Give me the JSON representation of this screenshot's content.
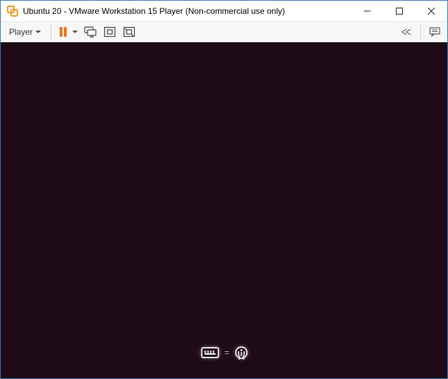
{
  "window": {
    "title": "Ubuntu 20 - VMware Workstation 15 Player (Non-commercial use only)"
  },
  "toolbar": {
    "player_label": "Player",
    "accent_color": "#f26f21"
  },
  "guest": {
    "background": "#1f0a17",
    "equals": "="
  },
  "icons": {
    "app": "vmware-icon",
    "minimize": "minimize-icon",
    "maximize": "maximize-icon",
    "close": "close-icon",
    "pause": "pause-icon",
    "dropdown": "chevron-down-icon",
    "send_keys": "send-keys-icon",
    "fullscreen": "fullscreen-icon",
    "unity": "unity-icon",
    "cycle": "cycle-icon",
    "messages": "messages-icon",
    "keyboard": "keyboard-icon",
    "accessibility": "accessibility-icon"
  }
}
